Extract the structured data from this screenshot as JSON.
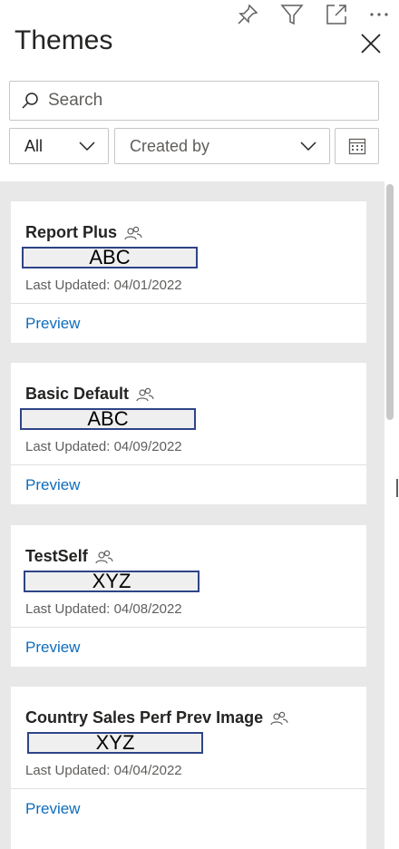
{
  "toolbar": {
    "icons": [
      "pin-icon",
      "filter-icon",
      "focus-mode-icon",
      "more-options-icon"
    ]
  },
  "pane": {
    "title": "Themes"
  },
  "search": {
    "placeholder": "Search",
    "value": ""
  },
  "filters": {
    "type_selected": "All",
    "created_by_placeholder": "Created by"
  },
  "themes": [
    {
      "name": "Report Plus",
      "author": "ABC",
      "updated": "Last Updated: 04/01/2022",
      "preview": "Preview",
      "shared": true
    },
    {
      "name": "Basic Default",
      "author": "ABC",
      "updated": "Last Updated: 04/09/2022",
      "preview": "Preview",
      "shared": true
    },
    {
      "name": "TestSelf",
      "author": "XYZ",
      "updated": "Last Updated: 04/08/2022",
      "preview": "Preview",
      "shared": true
    },
    {
      "name": "Country Sales Perf Prev Image",
      "author": "XYZ",
      "updated": "Last Updated: 04/04/2022",
      "preview": "Preview",
      "shared": true
    }
  ],
  "colors": {
    "link": "#0f6cbd",
    "list_background": "#e8e8e8",
    "redaction_border": "#2e4486"
  }
}
